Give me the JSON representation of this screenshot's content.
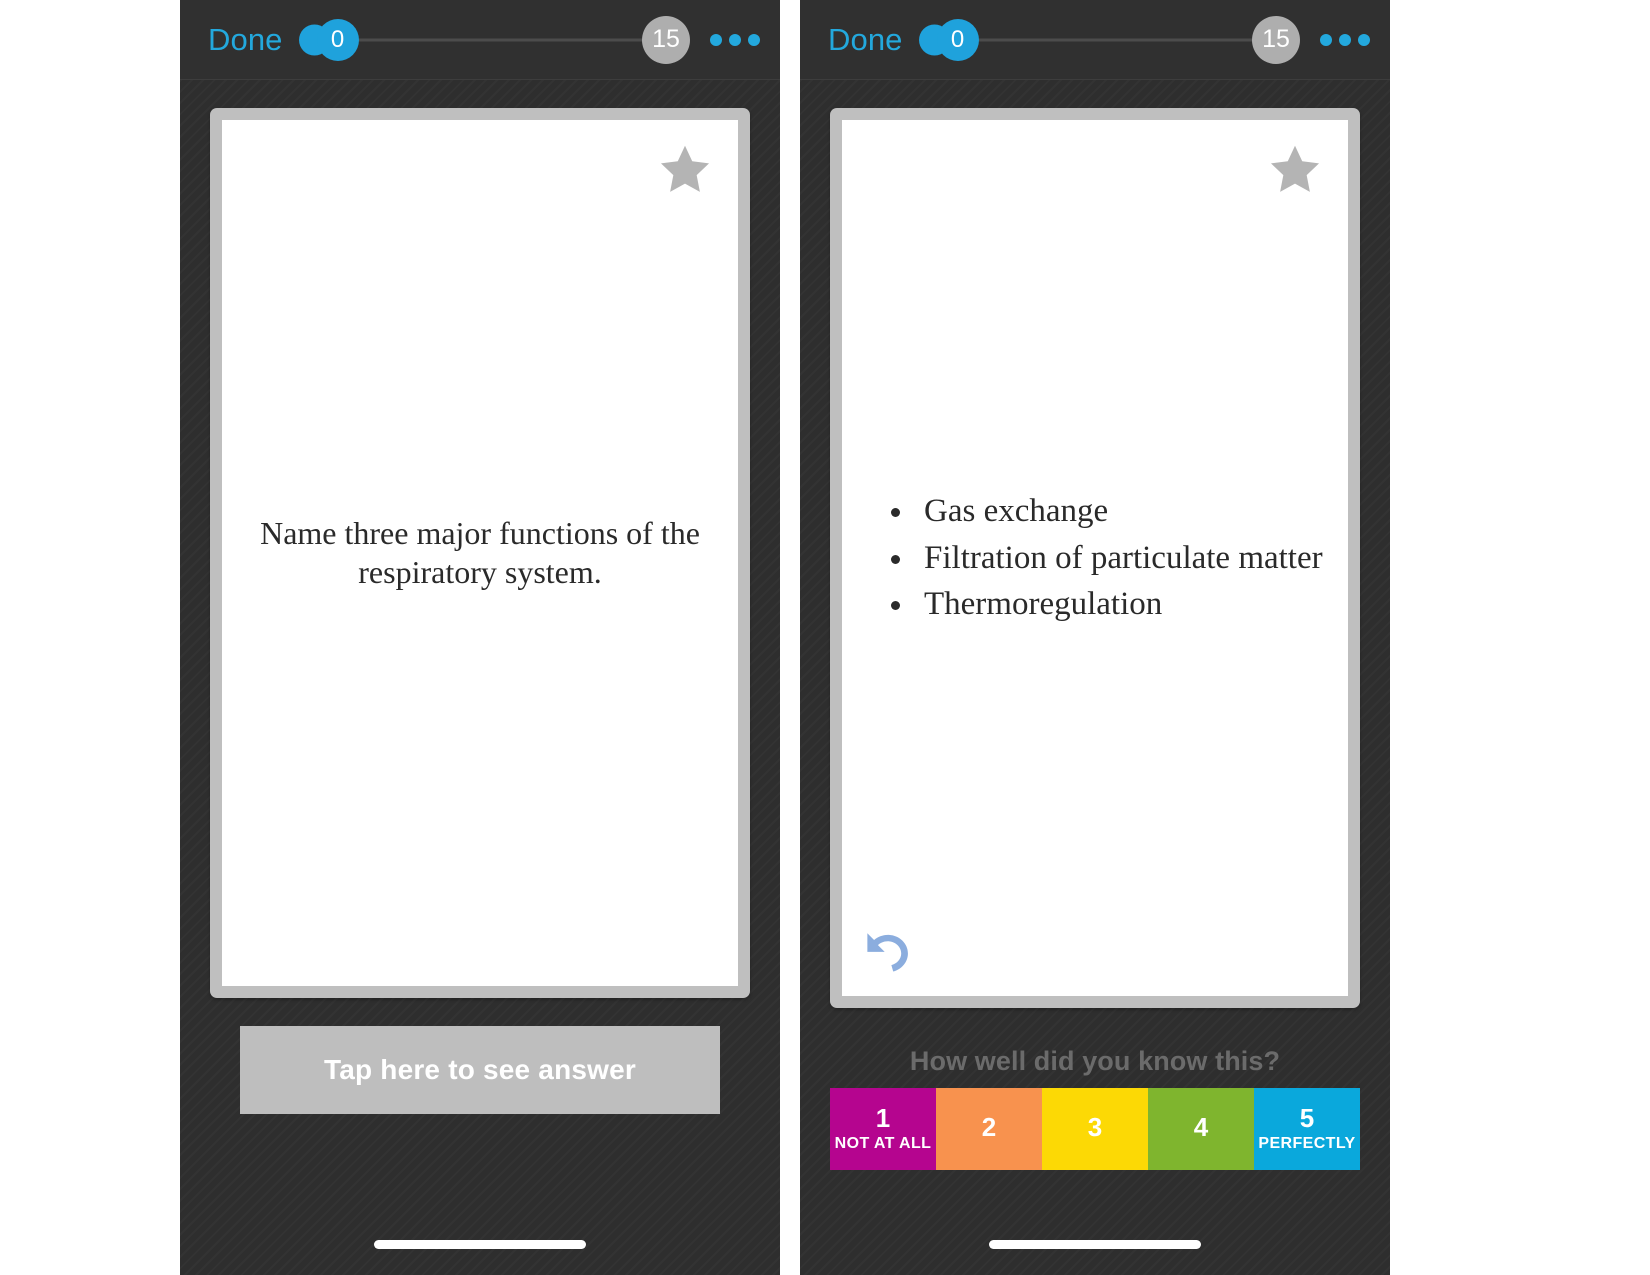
{
  "app": {
    "background_color": "#2e2e2e",
    "accent_blue": "#23a8dd",
    "card_border_color": "#bfbfbf"
  },
  "screens": [
    {
      "id": "question-screen",
      "navbar": {
        "done_label": "Done",
        "progress_current": "0",
        "progress_total": "15",
        "more_icon": "ellipsis-icon"
      },
      "card": {
        "star_icon": "star-icon",
        "star_state": "inactive",
        "question_text": "Name three major functions of the respiratory system."
      },
      "action": {
        "see_answer_label": "Tap here to see answer"
      }
    },
    {
      "id": "answer-screen",
      "navbar": {
        "done_label": "Done",
        "progress_current": "0",
        "progress_total": "15",
        "more_icon": "ellipsis-icon"
      },
      "card": {
        "star_icon": "star-icon",
        "star_state": "inactive",
        "undo_icon": "undo-arrow-icon",
        "answer_items": [
          "Gas exchange",
          "Filtration of particulate matter",
          "Thermoregulation"
        ]
      },
      "rating": {
        "prompt": "How well did you know this?",
        "buttons": [
          {
            "number": "1",
            "sub": "NOT AT ALL",
            "color": "#b5058f"
          },
          {
            "number": "2",
            "sub": "",
            "color": "#f8924e"
          },
          {
            "number": "3",
            "sub": "",
            "color": "#fcd905"
          },
          {
            "number": "4",
            "sub": "",
            "color": "#7fb52e"
          },
          {
            "number": "5",
            "sub": "PERFECTLY",
            "color": "#0aa8dc"
          }
        ]
      }
    }
  ]
}
